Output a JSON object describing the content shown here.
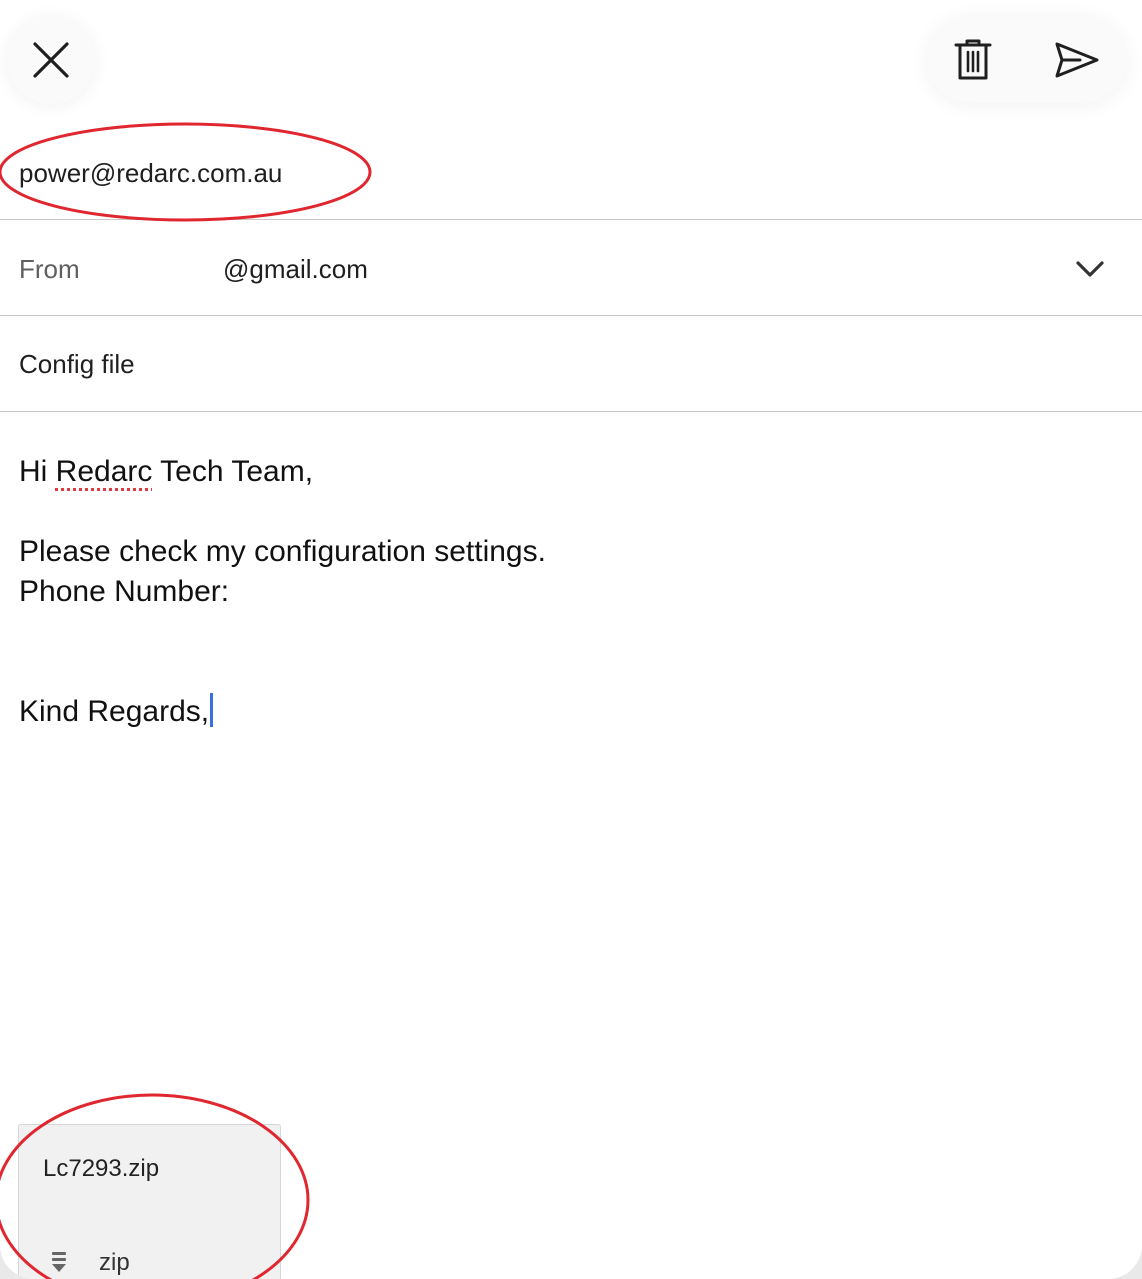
{
  "toolbar": {
    "close_icon": "close-icon",
    "delete_icon": "trash-icon",
    "send_icon": "send-icon"
  },
  "compose": {
    "to": "power@redarc.com.au",
    "from_label": "From",
    "from_value": "@gmail.com",
    "subject": "Config file",
    "body": {
      "greeting_prefix": "Hi ",
      "greeting_name": "Redarc",
      "greeting_suffix": " Tech Team,",
      "line_check": "Please check my configuration settings.",
      "line_phone": "Phone Number:",
      "closing": "Kind Regards,"
    }
  },
  "attachment": {
    "name": "Lc7293.zip",
    "type": "zip",
    "icon": "archive-icon"
  },
  "colors": {
    "annotation": "#e0262f",
    "caret": "#3b6fe0",
    "spellcheck": "#e0393e"
  }
}
